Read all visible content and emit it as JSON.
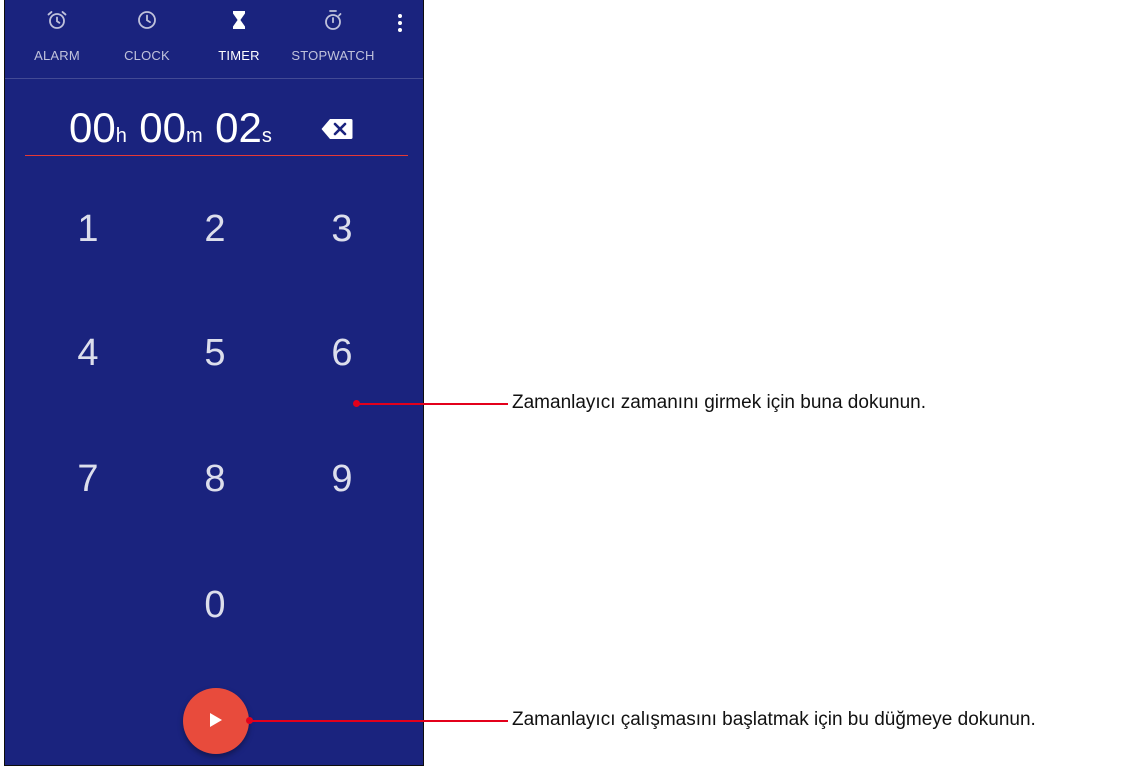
{
  "tabs": [
    {
      "label": "ALARM",
      "icon": "alarm-icon"
    },
    {
      "label": "CLOCK",
      "icon": "clock-icon"
    },
    {
      "label": "TIMER",
      "icon": "hourglass-icon"
    },
    {
      "label": "STOPWATCH",
      "icon": "stopwatch-icon"
    }
  ],
  "active_tab": "TIMER",
  "timer": {
    "hours": "00",
    "hours_unit": "h",
    "minutes": "00",
    "minutes_unit": "m",
    "seconds": "02",
    "seconds_unit": "s"
  },
  "keypad": [
    "1",
    "2",
    "3",
    "4",
    "5",
    "6",
    "7",
    "8",
    "9",
    "0"
  ],
  "annotations": {
    "keypad_note": "Zamanlayıcı zamanını girmek için buna dokunun.",
    "start_note": "Zamanlayıcı çalışmasını başlatmak için bu düğmeye dokunun."
  },
  "colors": {
    "background": "#1a237e",
    "accent": "#e84b3c",
    "callout": "#e3001b"
  }
}
